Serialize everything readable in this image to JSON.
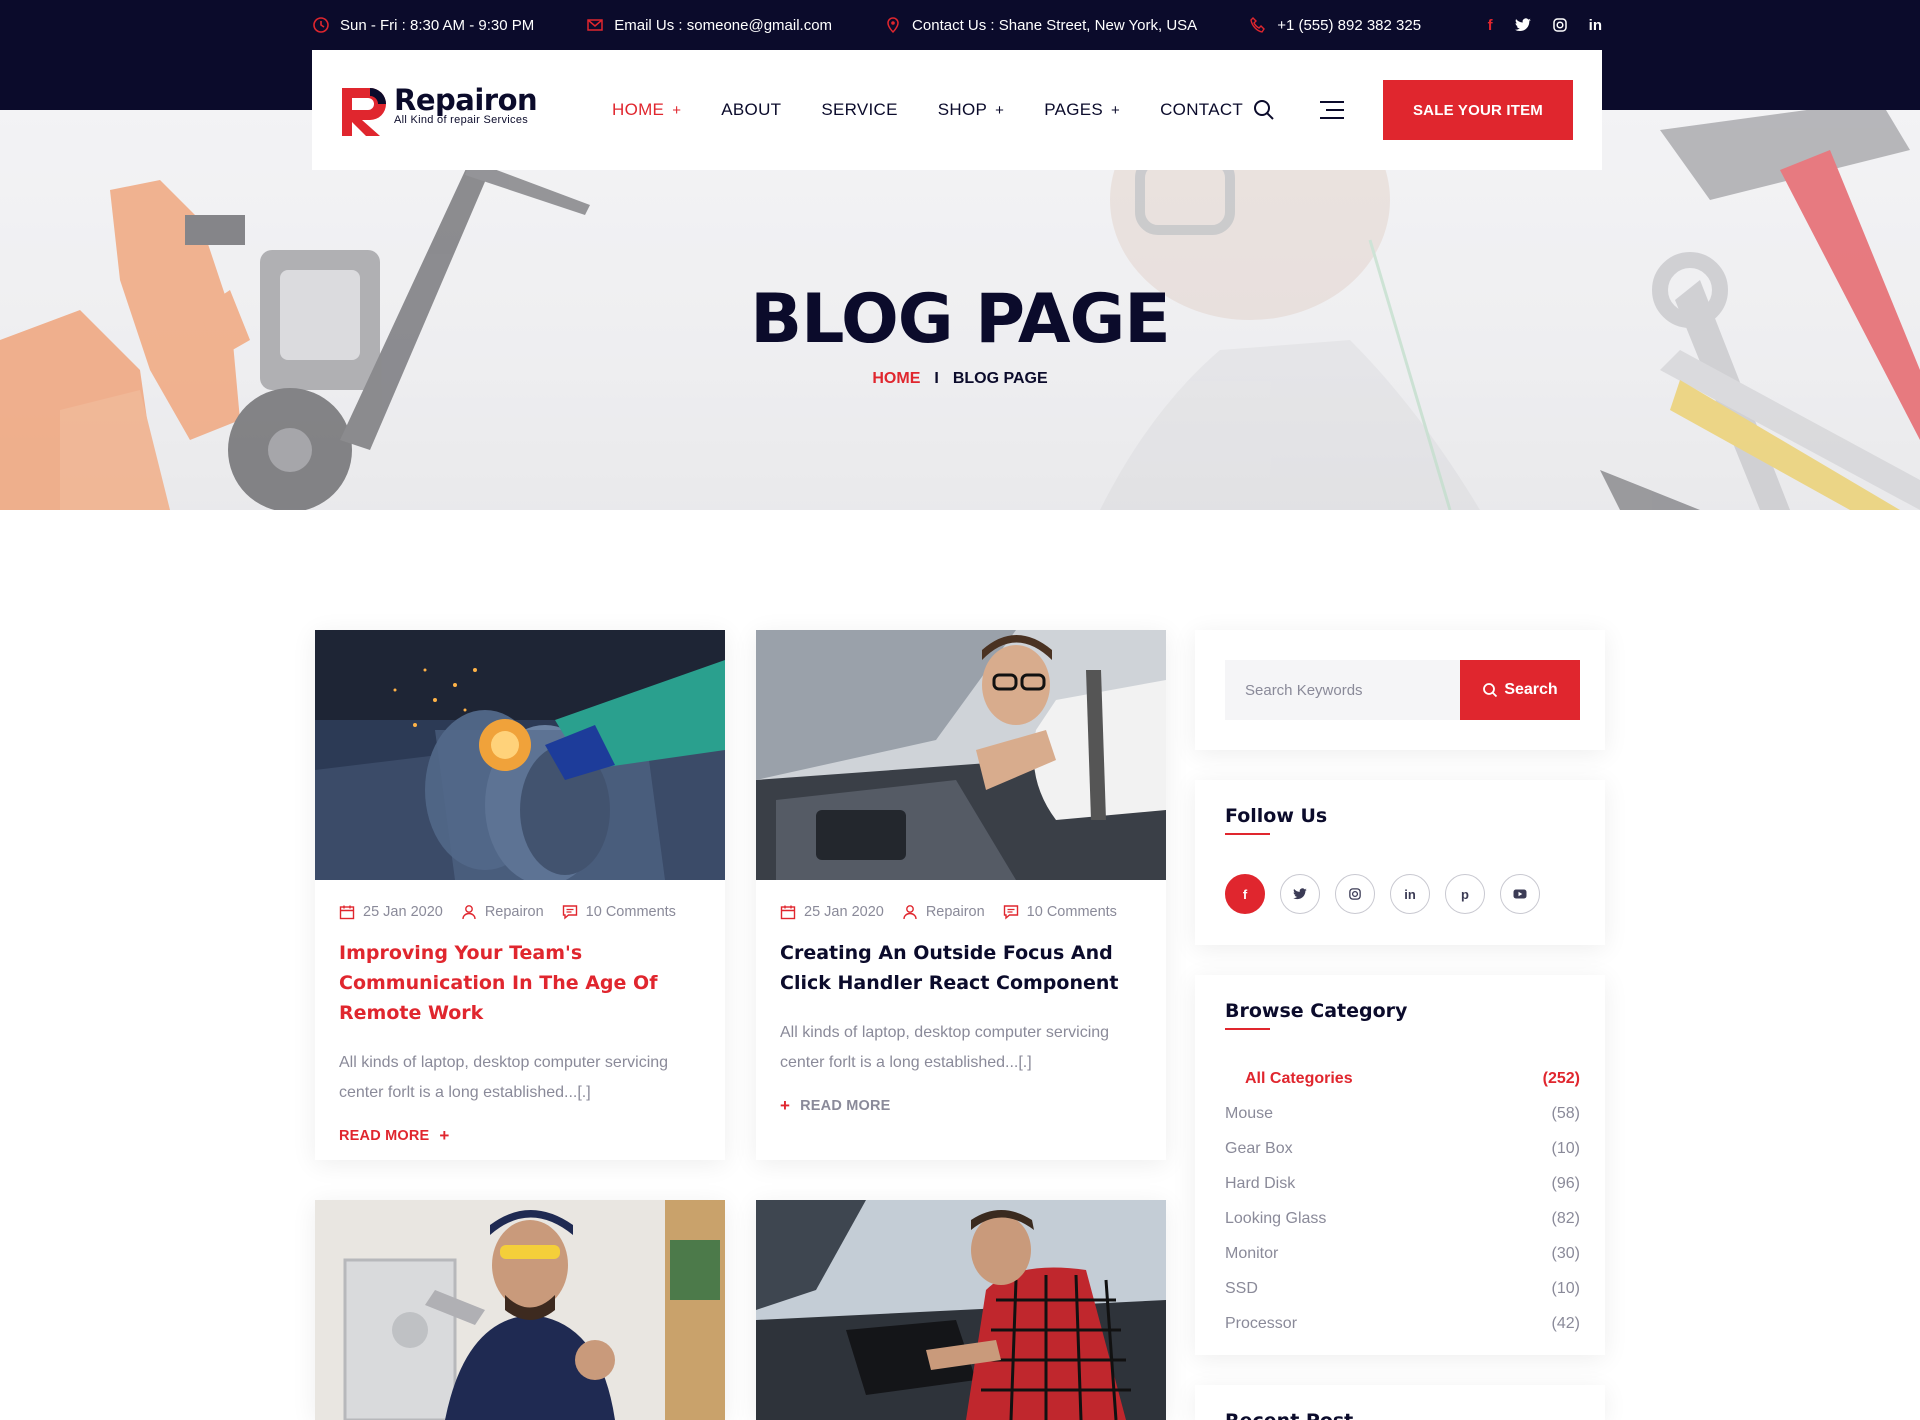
{
  "topbar": {
    "hours": "Sun - Fri : 8:30 AM - 9:30 PM",
    "email": "Email Us : someone@gmail.com",
    "address": "Contact Us : Shane Street, New York, USA",
    "phone": "+1 (555) 892 382 325",
    "social": [
      "f",
      "t",
      "ig",
      "in"
    ]
  },
  "brand": {
    "name": "Repairon",
    "tagline": "All Kind of repair Services"
  },
  "nav": {
    "items": [
      {
        "label": "HOME",
        "plus": "+"
      },
      {
        "label": "ABOUT",
        "plus": ""
      },
      {
        "label": "SERVICE",
        "plus": ""
      },
      {
        "label": "SHOP",
        "plus": "+"
      },
      {
        "label": "PAGES",
        "plus": "+"
      },
      {
        "label": "CONTACT",
        "plus": ""
      }
    ],
    "cta": "SALE YOUR ITEM"
  },
  "hero": {
    "title": "BLOG PAGE",
    "breadcrumb_home": "HOME",
    "breadcrumb_sep": "I",
    "breadcrumb_current": "BLOG PAGE"
  },
  "posts": [
    {
      "date": "25 Jan 2020",
      "author": "Repairon",
      "comments": "10 Comments",
      "title": "Improving Your Team's Communication In The Age Of Remote Work",
      "excerpt": "All kinds of laptop, desktop computer servicing center forlt is a long established...[.]",
      "more": "READ MORE",
      "more_icon": "+"
    },
    {
      "date": "25 Jan 2020",
      "author": "Repairon",
      "comments": "10 Comments",
      "title": "Creating An Outside Focus And Click Handler React Component",
      "excerpt": "All kinds of laptop, desktop computer servicing center forlt is a long established...[.]",
      "more": "READ MORE",
      "more_icon": "+"
    }
  ],
  "sidebar": {
    "search_placeholder": "Search Keywords",
    "search_button": "Search",
    "follow_title": "Follow Us",
    "follow_icons": [
      "f",
      "t",
      "ig",
      "in",
      "p",
      "yt"
    ],
    "category_title": "Browse Category",
    "categories": [
      {
        "name": "All Categories",
        "count": "(252)"
      },
      {
        "name": "Mouse",
        "count": "(58)"
      },
      {
        "name": "Gear Box",
        "count": "(10)"
      },
      {
        "name": "Hard Disk",
        "count": "(96)"
      },
      {
        "name": "Looking Glass",
        "count": "(82)"
      },
      {
        "name": "Monitor",
        "count": "(30)"
      },
      {
        "name": "SSD",
        "count": "(10)"
      },
      {
        "name": "Processor",
        "count": "(42)"
      }
    ],
    "recent_title": "Recent Post"
  },
  "colors": {
    "accent": "#e0262e",
    "dark": "#0b0b2b",
    "muted": "#8a8a99"
  }
}
